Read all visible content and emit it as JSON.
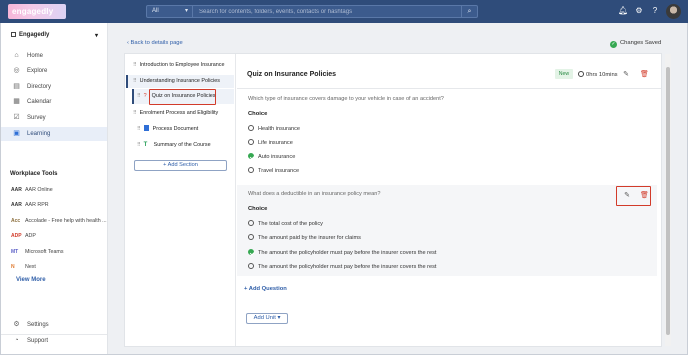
{
  "topbar": {
    "logo_text": "engagedly",
    "search_scope": "All",
    "search_placeholder": "Search for contents, folders, events, contacts or hashtags",
    "icons": [
      "search-icon",
      "bell-icon",
      "gear-icon",
      "question-icon"
    ]
  },
  "sidebar": {
    "org_name": "Engagedly",
    "items": [
      {
        "label": "Home",
        "icon": "home-icon"
      },
      {
        "label": "Explore",
        "icon": "compass-icon"
      },
      {
        "label": "Directory",
        "icon": "directory-icon"
      },
      {
        "label": "Calendar",
        "icon": "calendar-icon"
      },
      {
        "label": "Survey",
        "icon": "survey-icon"
      },
      {
        "label": "Learning",
        "icon": "learning-icon",
        "active": true
      }
    ],
    "tools_heading": "Workplace Tools",
    "tools": [
      {
        "label": "AAR Online",
        "icon_text": "AAR"
      },
      {
        "label": "AAR RPR",
        "icon_text": "AAR"
      },
      {
        "label": "Accolade - Free help with health ...",
        "icon_text": "Acc"
      },
      {
        "label": "ADP",
        "icon_text": "ADP"
      },
      {
        "label": "Microsoft Teams",
        "icon_text": "MT"
      },
      {
        "label": "Next",
        "icon_text": "N"
      }
    ],
    "view_more": "View More",
    "bottom": [
      {
        "label": "Settings",
        "icon": "gear-icon"
      },
      {
        "label": "Support",
        "icon": "support-icon"
      }
    ]
  },
  "main": {
    "back_link": "Back to details page",
    "saved_status": "Changes Saved",
    "tree": {
      "units": [
        {
          "title": "Introduction to Employee Insurance"
        },
        {
          "title": "Understanding Insurance Policies",
          "lessons": [
            {
              "title": "Quiz on Insurance Policies",
              "selected": true
            }
          ]
        },
        {
          "title": "Enrolment Process and Eligibility",
          "lessons": [
            {
              "title": "Process Document"
            },
            {
              "title": "Summary of the Course"
            }
          ]
        }
      ],
      "add_section": "+ Add Section"
    },
    "quiz": {
      "title": "Quiz on Insurance Policies",
      "badge": "New",
      "duration": "0hrs 10mins",
      "questions": [
        {
          "text": "Which type of insurance covers damage to your vehicle in case of an accident?",
          "choice_label": "Choice",
          "options": [
            "Health insurance",
            "Life insurance",
            "Auto insurance",
            "Travel insurance"
          ],
          "correct_index": 2
        },
        {
          "text": "What does a deductible in an insurance policy mean?",
          "choice_label": "Choice",
          "options": [
            "The total cost of the policy",
            "The amount paid by the insurer for claims",
            "The amount the policyholder must pay before the insurer covers the rest",
            "The amount the policyholder must pay before the insurer covers the rest"
          ],
          "correct_index": 2
        }
      ],
      "add_question": "+ Add Question",
      "add_unit": "Add Unit"
    }
  },
  "colors": {
    "topbar": "#2f4c7a",
    "accent": "#2f5ea8",
    "success": "#36a852",
    "danger": "#d23b2a"
  }
}
